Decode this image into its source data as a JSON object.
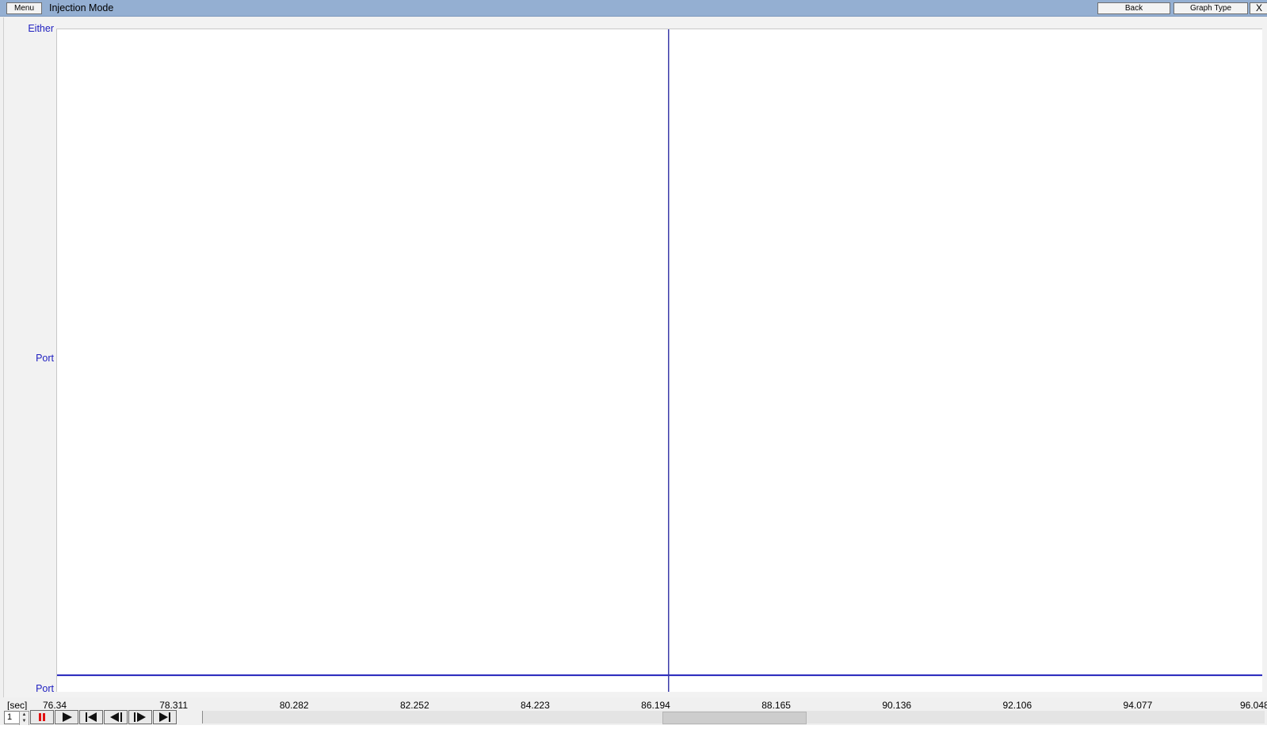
{
  "toolbar": {
    "menu_label": "Menu",
    "title": "Injection Mode",
    "back_label": "Back",
    "graph_type_label": "Graph Type",
    "close_label": "X"
  },
  "colors": {
    "title_bar": "#94afd2",
    "series": "#2222bb",
    "cursor_line": "#3b3ba8",
    "axis_label": "#2020c0",
    "pause_icon": "#e01010"
  },
  "chart_data": {
    "type": "line",
    "xlabel": "[sec]",
    "ylabel": "",
    "y_categories": [
      "Port",
      "Port",
      "Either"
    ],
    "x_ticks": [
      "76.34",
      "78.311",
      "80.282",
      "82.252",
      "84.223",
      "86.194",
      "88.165",
      "90.136",
      "92.106",
      "94.077",
      "96.048"
    ],
    "xlim": [
      76.34,
      96.048
    ],
    "cursor_x": 86.34,
    "series": [
      {
        "x": [
          76.34,
          96.048
        ],
        "y": [
          0.025,
          0.025
        ]
      }
    ],
    "ylim": [
      0,
      1
    ],
    "grid": false
  },
  "controls": {
    "spin_value": "1",
    "pause_icon": "pause-icon",
    "play_icon": "play-icon",
    "skip_start_icon": "skip-to-start-icon",
    "step_back_icon": "step-back-icon",
    "step_forward_icon": "step-forward-icon",
    "skip_end_icon": "skip-to-end-icon",
    "scroll_position": 0.5
  }
}
